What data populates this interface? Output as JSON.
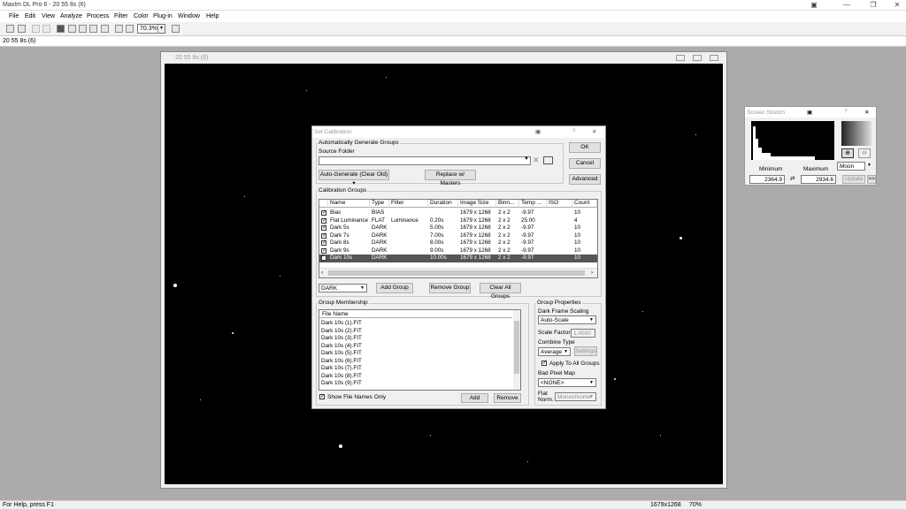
{
  "app": {
    "title": "MaxIm DL Pro 6 - 20 55 8s (6)",
    "doc_tab": "20 55 8s (6)"
  },
  "menu": [
    "File",
    "Edit",
    "View",
    "Analyze",
    "Process",
    "Filter",
    "Color",
    "Plug-in",
    "Window",
    "Help"
  ],
  "toolbar": {
    "zoom": "70.3%"
  },
  "image_window": {
    "title": "20 55 8s (6)"
  },
  "status": {
    "left": "For Help, press F1",
    "size": "1679x1268",
    "zoom": "70%"
  },
  "dialog": {
    "title": "Set Calibration",
    "auto_group_label": "Automatically Generate Groups",
    "source_folder_label": "Source Folder",
    "source_folder_value": "",
    "auto_generate": "Auto-Generate (Clear Old)",
    "replace_masters": "Replace w/ Masters",
    "ok": "OK",
    "cancel": "Cancel",
    "advanced": "Advanced",
    "cal_groups_label": "Calibration Groups",
    "columns": [
      "Name",
      "Type",
      "Filter",
      "Duration",
      "Image Size",
      "Binn...",
      "Temp ...",
      "ISO",
      "Count"
    ],
    "rows": [
      {
        "name": "Bias",
        "type": "BIAS",
        "filter": "",
        "duration": "",
        "size": "1679 x 1268",
        "bin": "2 x 2",
        "temp": "-9.97",
        "iso": "",
        "count": "10"
      },
      {
        "name": "Flat Luminance",
        "type": "FLAT",
        "filter": "Luminance",
        "duration": "0.20s",
        "size": "1679 x 1268",
        "bin": "2 x 2",
        "temp": "25.00",
        "iso": "",
        "count": "4"
      },
      {
        "name": "Dark 5s",
        "type": "DARK",
        "filter": "",
        "duration": "5.00s",
        "size": "1679 x 1268",
        "bin": "2 x 2",
        "temp": "-9.97",
        "iso": "",
        "count": "10"
      },
      {
        "name": "Dark 7s",
        "type": "DARK",
        "filter": "",
        "duration": "7.00s",
        "size": "1679 x 1268",
        "bin": "2 x 2",
        "temp": "-9.97",
        "iso": "",
        "count": "10"
      },
      {
        "name": "Dark 8s",
        "type": "DARK",
        "filter": "",
        "duration": "8.00s",
        "size": "1679 x 1268",
        "bin": "2 x 2",
        "temp": "-9.97",
        "iso": "",
        "count": "10"
      },
      {
        "name": "Dark 9s",
        "type": "DARK",
        "filter": "",
        "duration": "9.00s",
        "size": "1679 x 1268",
        "bin": "2 x 2",
        "temp": "-9.97",
        "iso": "",
        "count": "10"
      },
      {
        "name": "Dark 10s",
        "type": "DARK",
        "filter": "",
        "duration": "10.00s",
        "size": "1679 x 1268",
        "bin": "2 x 2",
        "temp": "-9.97",
        "iso": "",
        "count": "10"
      }
    ],
    "type_select": "DARK",
    "add_group": "Add Group",
    "remove_group": "Remove Group",
    "clear_all": "Clear All Groups",
    "membership_label": "Group Membership",
    "file_col": "File Name",
    "files": [
      "Dark 10s (1).FIT",
      "Dark 10s (2).FIT",
      "Dark 10s (3).FIT",
      "Dark 10s (4).FIT",
      "Dark 10s (5).FIT",
      "Dark 10s (6).FIT",
      "Dark 10s (7).FIT",
      "Dark 10s (8).FIT",
      "Dark 10s (9).FIT"
    ],
    "show_names_only": "Show File Names Only",
    "add": "Add",
    "remove": "Remove",
    "props_label": "Group Properties",
    "dark_scaling_label": "Dark Frame Scaling",
    "dark_scaling": "Auto-Scale",
    "scale_factor_label": "Scale Factor",
    "scale_factor": "1.0000",
    "combine_label": "Combine Type",
    "combine": "Average",
    "settings": "Settings",
    "apply_all": "Apply To All Groups",
    "bad_pixel_label": "Bad Pixel Map",
    "bad_pixel": "<NONE>",
    "flat_norm_label1": "Flat",
    "flat_norm_label2": "Norm.",
    "flat_norm": "Monochrome"
  },
  "screen_stretch": {
    "title": "Screen Stretch",
    "min_label": "Minimum",
    "max_label": "Maximum",
    "min": "2364.9",
    "max": "2934.6",
    "mode": "Moon",
    "update": "Update",
    "more": ">>"
  }
}
